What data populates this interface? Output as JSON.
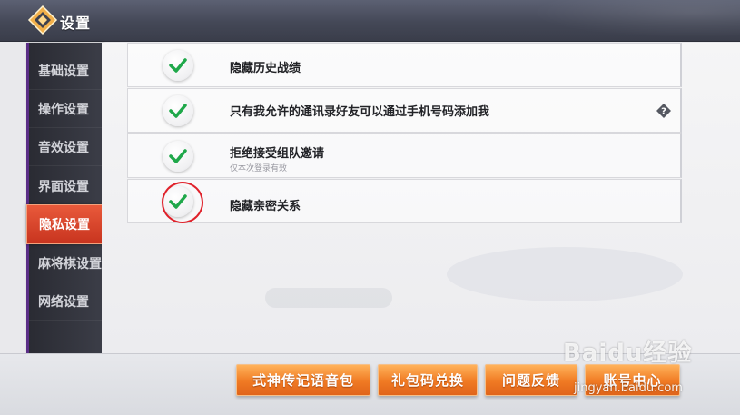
{
  "header": {
    "title": "设置",
    "logo_icon": "diamond-logo-icon"
  },
  "sidebar": {
    "items": [
      {
        "label": "基础设置",
        "active": false
      },
      {
        "label": "操作设置",
        "active": false
      },
      {
        "label": "音效设置",
        "active": false
      },
      {
        "label": "界面设置",
        "active": false
      },
      {
        "label": "隐私设置",
        "active": true
      },
      {
        "label": "麻将棋设置",
        "active": false
      },
      {
        "label": "网络设置",
        "active": false
      }
    ],
    "active_color": "#d9442a"
  },
  "privacy_options": [
    {
      "label": "隐藏历史战绩",
      "checked": true
    },
    {
      "label": "只有我允许的通讯录好友可以通过手机号码添加我",
      "checked": true,
      "help_icon": "question-diamond-icon"
    },
    {
      "label": "拒绝接受组队邀请",
      "sublabel": "仅本次登录有效",
      "checked": true
    },
    {
      "label": "隐藏亲密关系",
      "checked": true,
      "annotated": true
    }
  ],
  "bottom_buttons": [
    {
      "label": "式神传记语音包"
    },
    {
      "label": "礼包码兑换"
    },
    {
      "label": "问题反馈"
    },
    {
      "label": "账号中心"
    }
  ],
  "watermark": {
    "brand": "Baidu经验",
    "url": "jingyan.baidu.com"
  },
  "colors": {
    "check_green": "#1fa84a",
    "button_orange": "#f07a23",
    "annotation_red": "#e0212a"
  }
}
